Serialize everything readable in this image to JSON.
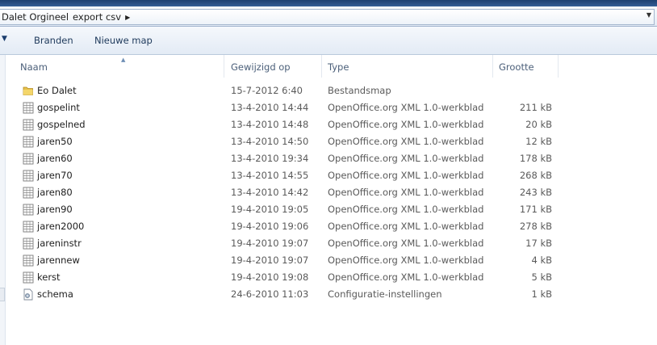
{
  "address": {
    "crumbs": [
      "Dalet Orgineel",
      "export csv"
    ]
  },
  "toolbar": {
    "burn_label": "Branden",
    "new_folder_label": "Nieuwe map"
  },
  "columns": {
    "name": "Naam",
    "date": "Gewijzigd op",
    "type": "Type",
    "size": "Grootte"
  },
  "files": [
    {
      "name": "Eo Dalet",
      "date": "15-7-2012 6:40",
      "type": "Bestandsmap",
      "size": "",
      "icon": "folder-icon"
    },
    {
      "name": "gospelint",
      "date": "13-4-2010 14:44",
      "type": "OpenOffice.org XML 1.0-werkblad",
      "size": "211 kB",
      "icon": "spreadsheet-icon"
    },
    {
      "name": "gospelned",
      "date": "13-4-2010 14:48",
      "type": "OpenOffice.org XML 1.0-werkblad",
      "size": "20 kB",
      "icon": "spreadsheet-icon"
    },
    {
      "name": "jaren50",
      "date": "13-4-2010 14:50",
      "type": "OpenOffice.org XML 1.0-werkblad",
      "size": "12 kB",
      "icon": "spreadsheet-icon"
    },
    {
      "name": "jaren60",
      "date": "13-4-2010 19:34",
      "type": "OpenOffice.org XML 1.0-werkblad",
      "size": "178 kB",
      "icon": "spreadsheet-icon"
    },
    {
      "name": "jaren70",
      "date": "13-4-2010 14:55",
      "type": "OpenOffice.org XML 1.0-werkblad",
      "size": "268 kB",
      "icon": "spreadsheet-icon"
    },
    {
      "name": "jaren80",
      "date": "13-4-2010 14:42",
      "type": "OpenOffice.org XML 1.0-werkblad",
      "size": "243 kB",
      "icon": "spreadsheet-icon"
    },
    {
      "name": "jaren90",
      "date": "19-4-2010 19:05",
      "type": "OpenOffice.org XML 1.0-werkblad",
      "size": "171 kB",
      "icon": "spreadsheet-icon"
    },
    {
      "name": "jaren2000",
      "date": "19-4-2010 19:06",
      "type": "OpenOffice.org XML 1.0-werkblad",
      "size": "278 kB",
      "icon": "spreadsheet-icon"
    },
    {
      "name": "jareninstr",
      "date": "19-4-2010 19:07",
      "type": "OpenOffice.org XML 1.0-werkblad",
      "size": "17 kB",
      "icon": "spreadsheet-icon"
    },
    {
      "name": "jarennew",
      "date": "19-4-2010 19:07",
      "type": "OpenOffice.org XML 1.0-werkblad",
      "size": "4 kB",
      "icon": "spreadsheet-icon"
    },
    {
      "name": "kerst",
      "date": "19-4-2010 19:08",
      "type": "OpenOffice.org XML 1.0-werkblad",
      "size": "5 kB",
      "icon": "spreadsheet-icon"
    },
    {
      "name": "schema",
      "date": "24-6-2010 11:03",
      "type": "Configuratie-instellingen",
      "size": "1 kB",
      "icon": "config-file-icon"
    }
  ]
}
